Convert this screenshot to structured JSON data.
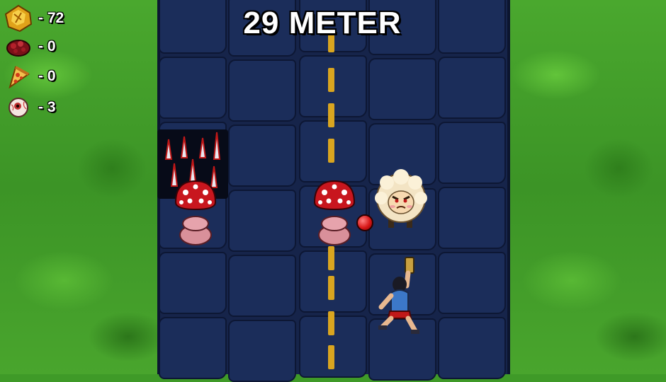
{
  "hud": {
    "distance": "29 METER",
    "counters": [
      {
        "icon": "gold-crystal-icon",
        "value": "- 72"
      },
      {
        "icon": "meat-chunk-icon",
        "value": "- 0"
      },
      {
        "icon": "pizza-slice-icon",
        "value": "- 0"
      },
      {
        "icon": "eyeball-icon",
        "value": "- 3"
      }
    ]
  },
  "colors": {
    "road": "#1b2d5a",
    "lane_marker": "#d9a520",
    "grass": "#4aa82e"
  }
}
